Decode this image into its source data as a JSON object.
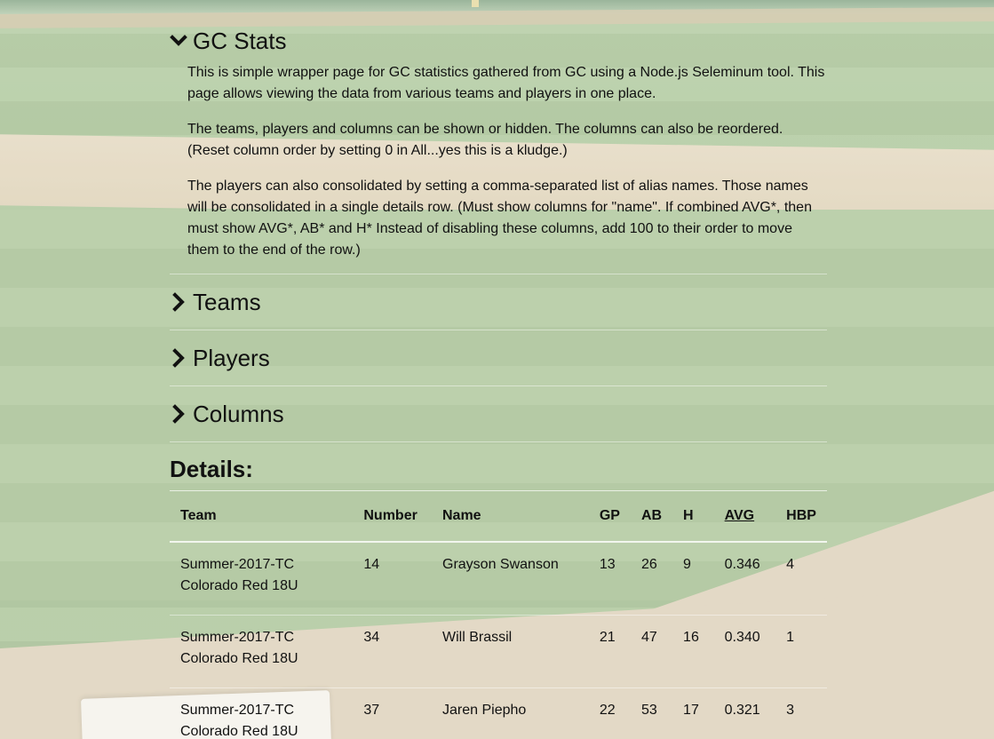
{
  "gc_section": {
    "title": "GC Stats",
    "paragraphs": [
      "This is simple wrapper page for GC statistics gathered from GC using a Node.js Seleminum tool. This page allows viewing the data from various teams and players in one place.",
      "The teams, players and columns can be shown or hidden. The columns can also be reordered. (Reset column order by setting 0 in All...yes this is a kludge.)",
      "The players can also consolidated by setting a comma-separated list of alias names. Those names will be consolidated in a single details row. (Must show columns for \"name\". If combined AVG*, then must show AVG*, AB* and H* Instead of disabling these columns, add 100 to their order to move them to the end of the row.)"
    ]
  },
  "sections": {
    "teams": "Teams",
    "players": "Players",
    "columns": "Columns"
  },
  "details": {
    "title": "Details:",
    "headers": {
      "team": "Team",
      "number": "Number",
      "name": "Name",
      "gp": "GP",
      "ab": "AB",
      "h": "H",
      "avg": "AVG",
      "hbp": "HBP"
    },
    "rows": [
      {
        "team_line1": "Summer-2017-TC",
        "team_line2": "Colorado Red 18U",
        "number": "14",
        "name": "Grayson Swanson",
        "gp": "13",
        "ab": "26",
        "h": "9",
        "avg": "0.346",
        "hbp": "4"
      },
      {
        "team_line1": "Summer-2017-TC",
        "team_line2": "Colorado Red 18U",
        "number": "34",
        "name": "Will Brassil",
        "gp": "21",
        "ab": "47",
        "h": "16",
        "avg": "0.340",
        "hbp": "1"
      },
      {
        "team_line1": "Summer-2017-TC",
        "team_line2": "Colorado Red 18U",
        "number": "37",
        "name": "Jaren Piepho",
        "gp": "22",
        "ab": "53",
        "h": "17",
        "avg": "0.321",
        "hbp": "3"
      }
    ]
  },
  "icons": {
    "expanded": "chevron-down-icon",
    "collapsed": "chevron-right-icon"
  }
}
